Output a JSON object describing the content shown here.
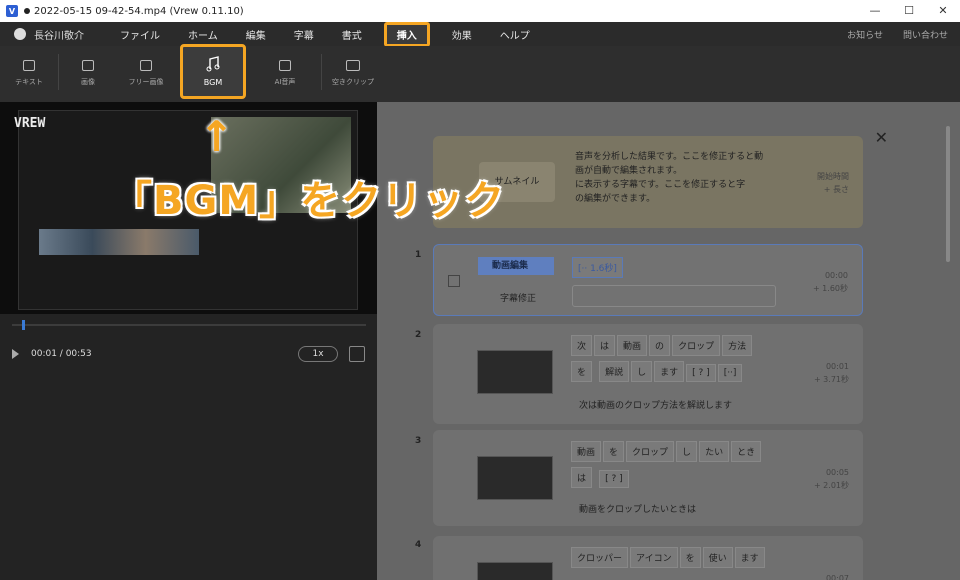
{
  "window": {
    "title": "2022-05-15 09-42-54.mp4 (Vrew 0.11.10)",
    "app_icon": "V",
    "controls": [
      "—",
      "☐",
      "✕"
    ]
  },
  "menu": {
    "user": "長谷川敬介",
    "items": [
      "ファイル",
      "ホーム",
      "編集",
      "字幕",
      "書式"
    ],
    "active": "挿入",
    "after_active": [
      "効果",
      "ヘルプ"
    ],
    "right": [
      "お知らせ",
      "問い合わせ"
    ]
  },
  "toolbar": {
    "tools": [
      "テキスト",
      "画像",
      "フリー画像"
    ],
    "bgm": "BGM",
    "after": [
      "AI音声",
      "空きクリップ"
    ]
  },
  "player": {
    "logo": "VREW",
    "time": "00:01 / 00:53",
    "speed": "1x"
  },
  "tutorial": {
    "thumb": "サムネイル",
    "line1": "音声を分析した結果です。ここを修正すると動",
    "line2": "画が自動で編集されます。",
    "line3": "に表示する字幕です。ここを修正すると字",
    "line4": "の編集ができます。",
    "time_label": "開始時間",
    "dur_label": "+ 長さ"
  },
  "clips": [
    {
      "num": "1",
      "label1": "動画編集",
      "chip": "[·· 1.6秒]",
      "label2": "字幕修正",
      "time": "00:00",
      "dur": "+ 1.60秒"
    },
    {
      "num": "2",
      "chips": [
        "次",
        "は",
        "動画",
        "の",
        "クロップ",
        "方法",
        "を",
        "解説",
        "し",
        "ます",
        "[ ? ]",
        "[··]"
      ],
      "sentence": "次は動画のクロップ方法を解説します",
      "time": "00:01",
      "dur": "+ 3.71秒"
    },
    {
      "num": "3",
      "chips": [
        "動画",
        "を",
        "クロップ",
        "し",
        "たい",
        "とき",
        "は",
        "[ ? ]"
      ],
      "sentence": "動画をクロップしたいときは",
      "time": "00:05",
      "dur": "+ 2.01秒"
    },
    {
      "num": "4",
      "chips": [
        "クロッパー",
        "アイコン",
        "を",
        "使い",
        "ます"
      ],
      "time": "00:07"
    }
  ],
  "annotation": {
    "arrow": "↑",
    "text": "「BGM」をクリック"
  },
  "colors": {
    "accent": "#f5a623",
    "selected": "#5a7ab8"
  }
}
